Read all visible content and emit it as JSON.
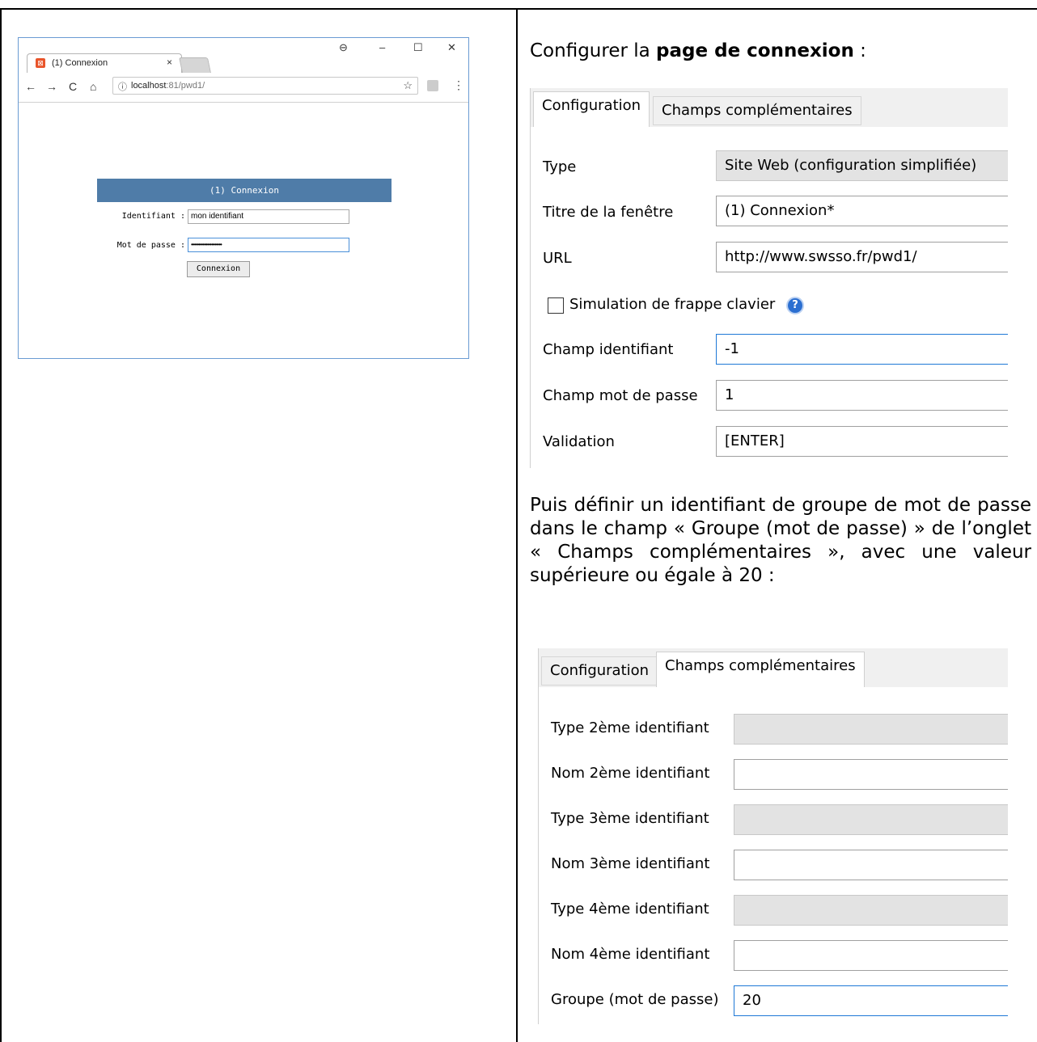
{
  "browser": {
    "tab_title": "(1) Connexion",
    "tab_close": "×",
    "favicon_icon": "xampp-favicon-icon",
    "window_controls": {
      "account": "⊖",
      "minimize": "–",
      "maximize": "☐",
      "close": "✕"
    },
    "nav": {
      "back": "←",
      "forward": "→",
      "reload": "C",
      "home": "⌂"
    },
    "address_info": "ⓘ",
    "address_host": "localhost",
    "address_path": ":81/pwd1/",
    "bookmark_star": "☆",
    "menu": "⋮",
    "form": {
      "header": "(1) Connexion",
      "id_label": "Identifiant :",
      "id_value": "mon identifiant",
      "pwd_label": "Mot de passe :",
      "pwd_value": "•••••••••••••••••••••",
      "submit": "Connexion"
    }
  },
  "right": {
    "heading_prefix": "Configurer la ",
    "heading_bold": "page de connexion",
    "heading_suffix": " :",
    "paragraph": "Puis définir un identifiant de groupe de mot de passe dans le champ « Groupe (mot de passe) » de l’onglet « Champs complémentaires », avec une valeur supérieure ou égale à 20 :"
  },
  "dialog1": {
    "tabs": [
      "Configuration",
      "Champs complémentaires"
    ],
    "type_label": "Type",
    "type_value": "Site Web (configuration simplifiée)",
    "title_label": "Titre de la fenêtre",
    "title_value": "(1) Connexion*",
    "url_label": "URL",
    "url_value": "http://www.swsso.fr/pwd1/",
    "simulation_label": "Simulation de frappe clavier",
    "help_icon": "?",
    "id_field_label": "Champ identifiant",
    "id_field_value": "-1",
    "pwd_field_label": "Champ mot de passe",
    "pwd_field_value": "1",
    "validation_label": "Validation",
    "validation_value": "[ENTER]"
  },
  "dialog2": {
    "tabs": [
      "Configuration",
      "Champs complémentaires"
    ],
    "fields": [
      {
        "label": "Type 2ème identifiant",
        "value": ""
      },
      {
        "label": "Nom 2ème identifiant",
        "value": ""
      },
      {
        "label": "Type 3ème identifiant",
        "value": ""
      },
      {
        "label": "Nom 3ème identifiant",
        "value": ""
      },
      {
        "label": "Type 4ème identifiant",
        "value": ""
      },
      {
        "label": "Nom 4ème identifiant",
        "value": ""
      },
      {
        "label": "Groupe (mot de passe)",
        "value": "20"
      }
    ]
  }
}
